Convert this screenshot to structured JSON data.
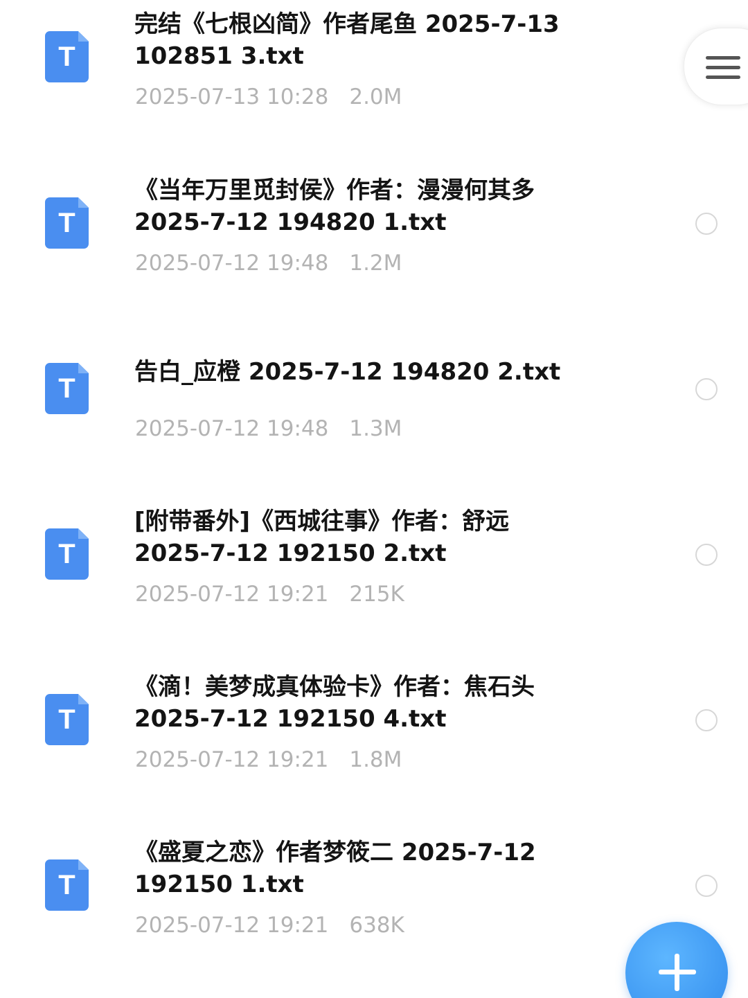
{
  "files": [
    {
      "name": "完结《七根凶简》作者尾鱼 2025-7-13\n102851 3.txt",
      "date": "2025-07-13 10:28",
      "size": "2.0M",
      "icon": "T"
    },
    {
      "name": "《当年万里觅封侯》作者：漫漫何其多\n2025-7-12 194820 1.txt",
      "date": "2025-07-12 19:48",
      "size": "1.2M",
      "icon": "T"
    },
    {
      "name": "告白_应橙 2025-7-12 194820 2.txt",
      "date": "2025-07-12 19:48",
      "size": "1.3M",
      "icon": "T"
    },
    {
      "name": "[附带番外]《西城往事》作者：舒远\n2025-7-12 192150 2.txt",
      "date": "2025-07-12 19:21",
      "size": "215K",
      "icon": "T"
    },
    {
      "name": "《滴！美梦成真体验卡》作者：焦石头\n2025-7-12 192150 4.txt",
      "date": "2025-07-12 19:21",
      "size": "1.8M",
      "icon": "T"
    },
    {
      "name": "《盛夏之恋》作者梦筱二 2025-7-12\n192150 1.txt",
      "date": "2025-07-12 19:21",
      "size": "638K",
      "icon": "T"
    }
  ],
  "icons": {
    "file": "txt-file-icon",
    "select": "radio-circle-icon",
    "menu": "hamburger-menu-icon",
    "add": "plus-icon"
  },
  "colors": {
    "file_icon": "#4a8ef0",
    "title_text": "#141414",
    "meta_text": "#b3b3b3",
    "fab": "#3e98f2"
  }
}
